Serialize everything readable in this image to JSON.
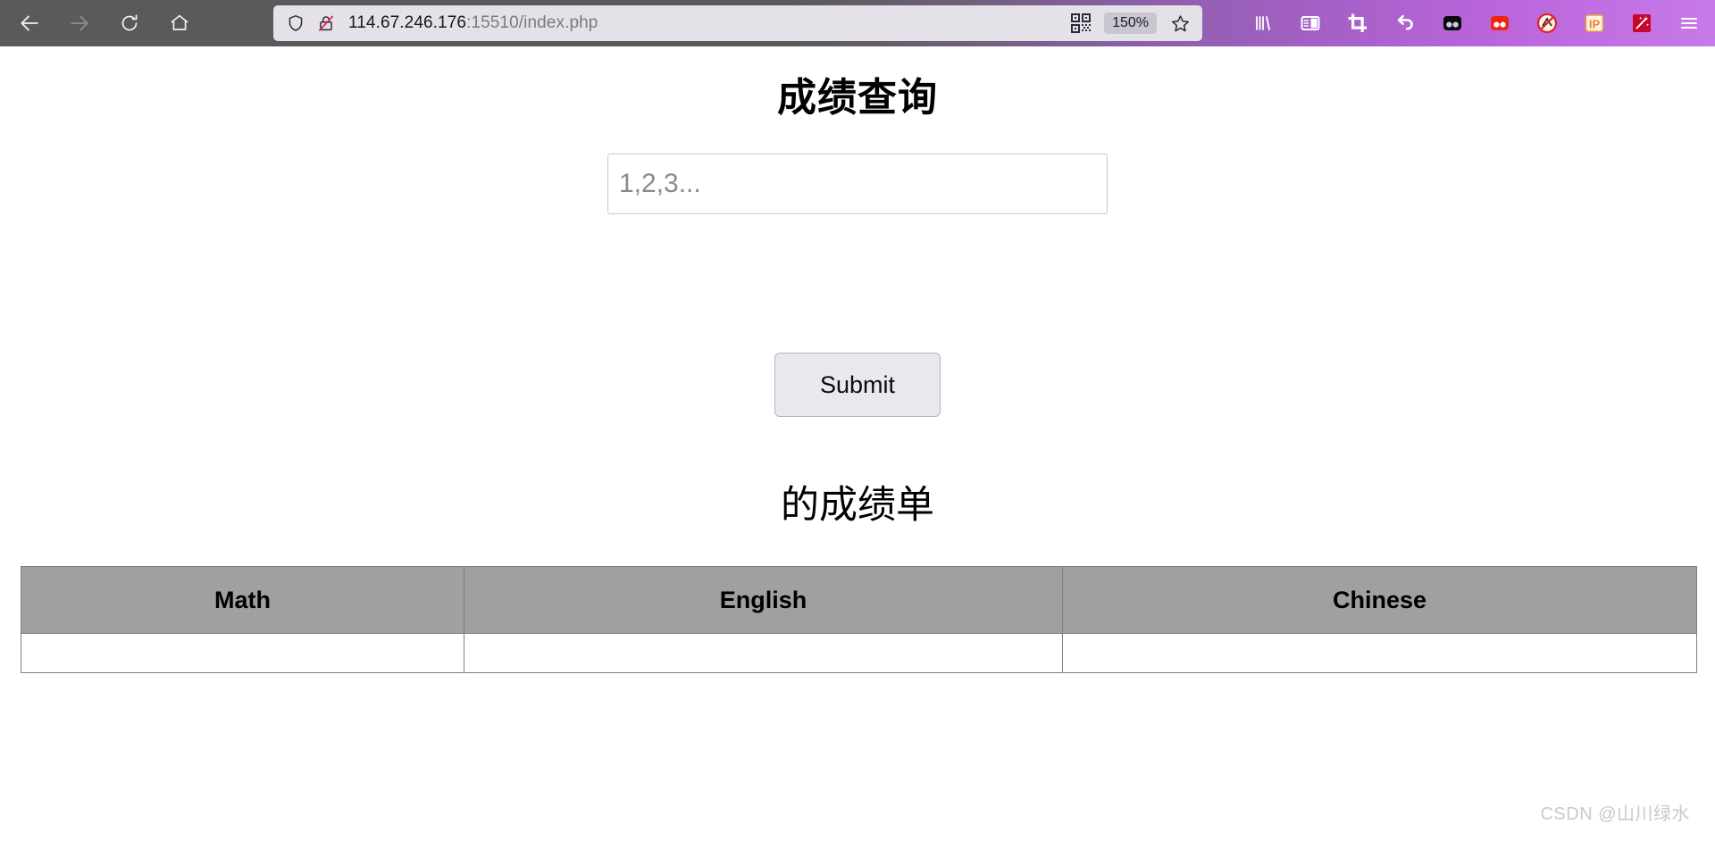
{
  "browser": {
    "nav": {
      "back_icon": "arrow-left-icon",
      "forward_icon": "arrow-right-icon",
      "reload_icon": "reload-icon",
      "home_icon": "home-icon"
    },
    "url_bar": {
      "shield_icon": "shield-icon",
      "insecure_icon": "broken-lock-icon",
      "host": "114.67.246.176",
      "rest": ":15510/index.php",
      "full_url": "114.67.246.176:15510/index.php",
      "qr_icon": "qr-code-icon",
      "zoom_level": "150%",
      "bookmark_icon": "star-icon"
    },
    "toolbar_right": [
      {
        "name": "library-icon",
        "label": "Library"
      },
      {
        "name": "sidebar-icon",
        "label": "Sidebar"
      },
      {
        "name": "crop-icon",
        "label": "Screenshot"
      },
      {
        "name": "undo-arrow-icon",
        "label": "Undo"
      },
      {
        "name": "black-goggles-icon",
        "label": "Extension"
      },
      {
        "name": "red-goggles-icon",
        "label": "Extension"
      },
      {
        "name": "no-ads-icon",
        "label": "Ad Blocker"
      },
      {
        "name": "ip-badge-icon",
        "label": "IP"
      },
      {
        "name": "magic-wand-icon",
        "label": "Magic Wand"
      },
      {
        "name": "hamburger-menu-icon",
        "label": "Menu"
      }
    ],
    "colors": {
      "chrome_left": "#5a5a5a",
      "chrome_right": "#c77ae8",
      "url_bar_bg": "#e4e1e9"
    }
  },
  "page": {
    "title": "成绩查询",
    "search": {
      "placeholder": "1,2,3...",
      "value": ""
    },
    "submit_label": "Submit",
    "report_title": "的成绩单",
    "table": {
      "headers": [
        "Math",
        "English",
        "Chinese"
      ],
      "rows": [
        [
          "",
          "",
          ""
        ]
      ],
      "header_bg": "#a0a0a0",
      "border_color": "#808080"
    }
  },
  "watermark": "CSDN @山川绿水"
}
